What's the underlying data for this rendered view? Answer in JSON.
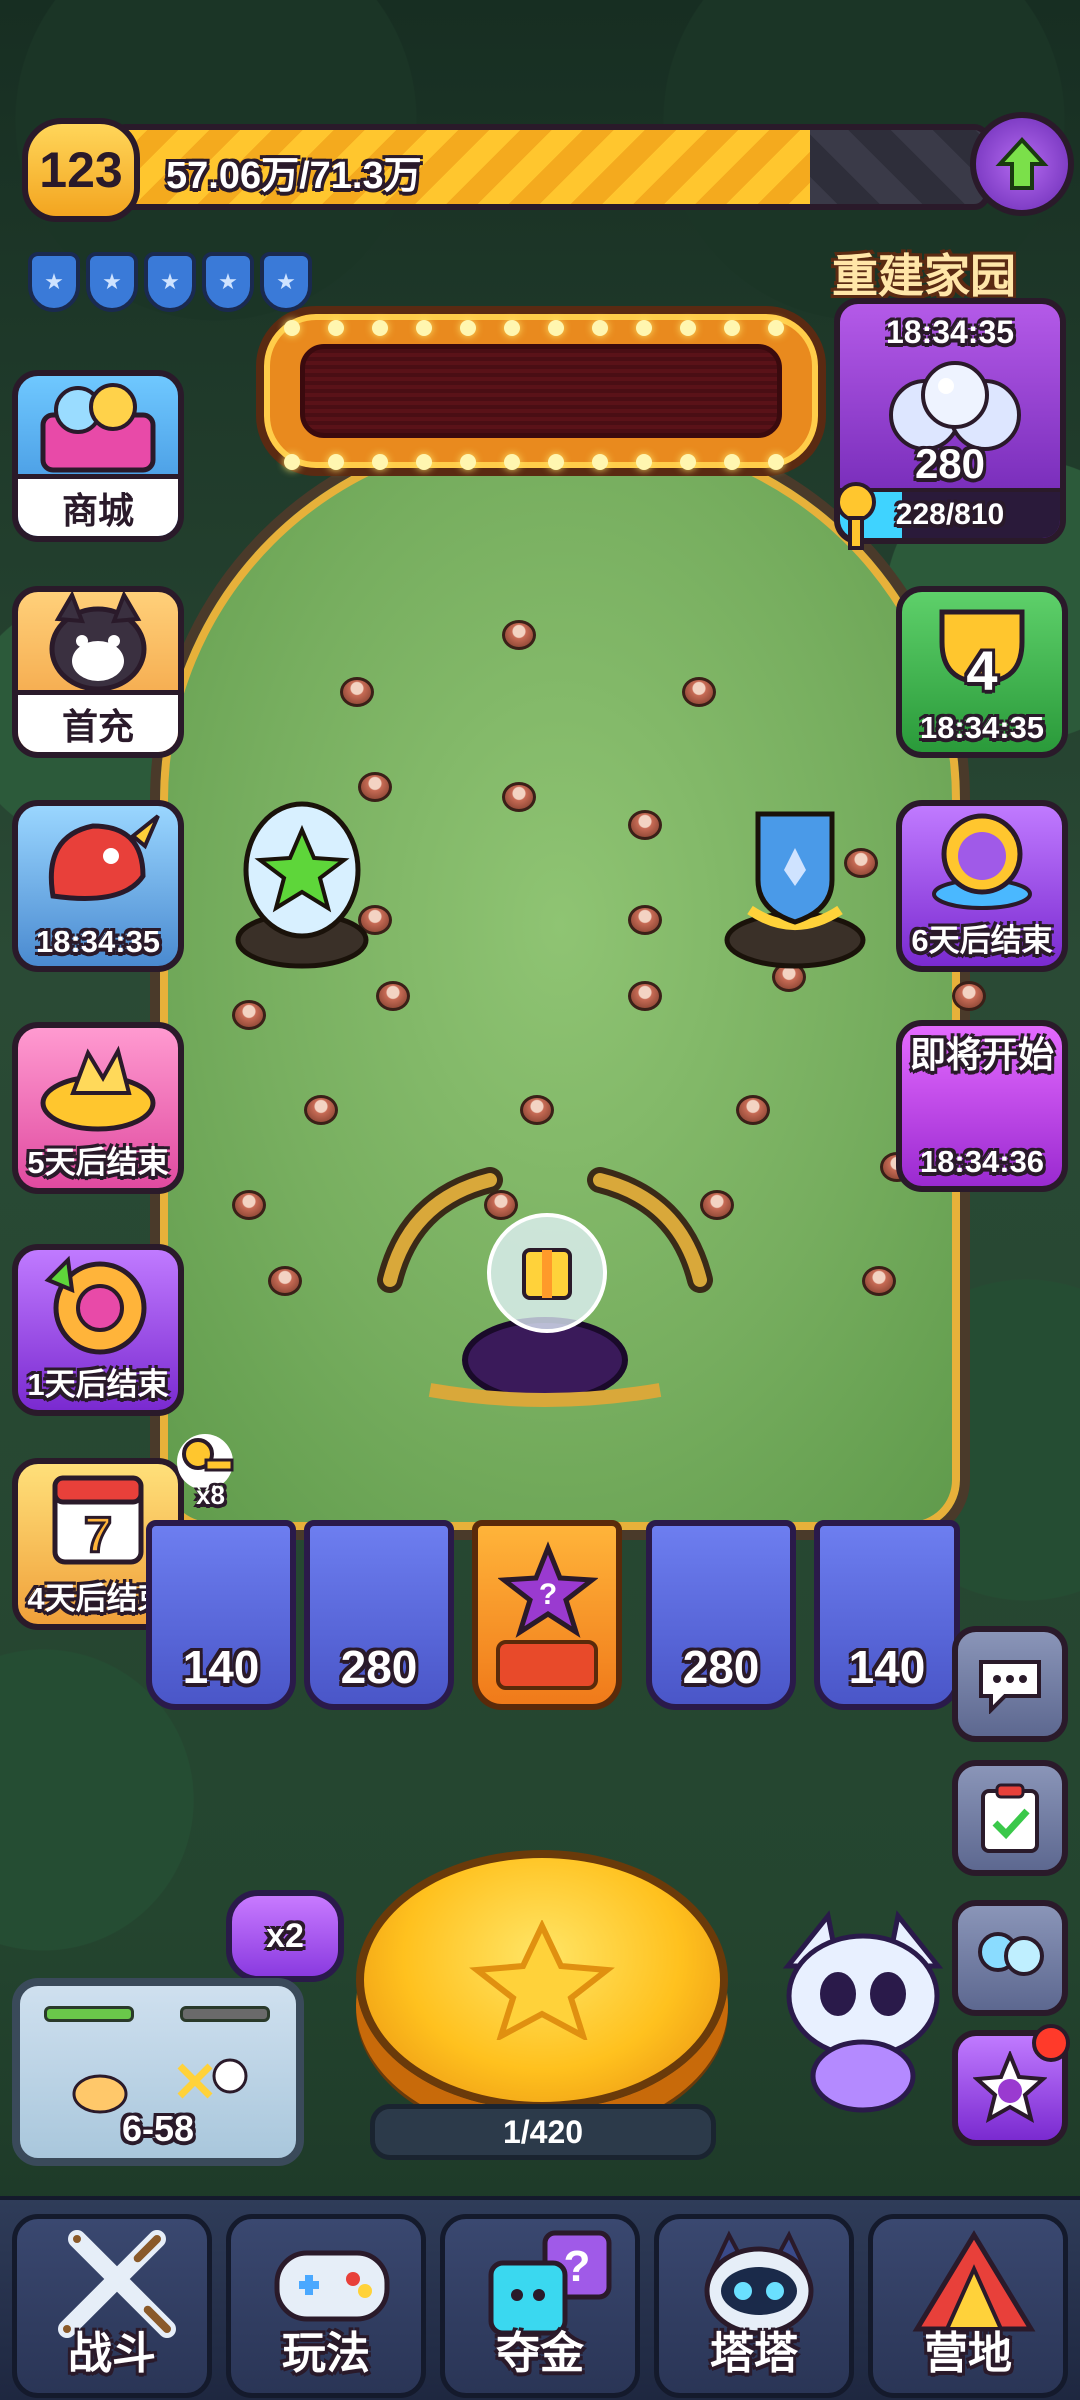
{
  "player": {
    "level": "123",
    "xp_text": "57.06万/71.3万",
    "xp_progress": 0.8
  },
  "shields": {
    "count": 5
  },
  "home_event": {
    "title": "重建家园",
    "timer": "18:34:35",
    "reward_count": "280",
    "progress_text": "228/810",
    "progress": 0.28
  },
  "left_buttons": [
    {
      "id": "shop",
      "label": "商城"
    },
    {
      "id": "first-recharge",
      "label": "首充"
    },
    {
      "id": "event-bird",
      "label": "18:34:35"
    },
    {
      "id": "event-gold",
      "label": "5天后结束"
    },
    {
      "id": "event-wheel",
      "label": "1天后结束"
    },
    {
      "id": "event-calendar",
      "label": "4天后结束",
      "calendar_day": "7"
    }
  ],
  "right_buttons": [
    {
      "id": "trophy",
      "label": "18:34:35",
      "count": "4"
    },
    {
      "id": "cat-medal",
      "label": "6天后结束"
    },
    {
      "id": "upcoming",
      "label_top": "即将开始",
      "label": "18:34:36"
    }
  ],
  "key_multiplier": "x8",
  "slots": [
    {
      "value": "140"
    },
    {
      "value": "280"
    },
    {
      "value": "mystery"
    },
    {
      "value": "280"
    },
    {
      "value": "140"
    }
  ],
  "multiplier_button": "x2",
  "spin_progress": "1/420",
  "stage": {
    "label": "6-58"
  },
  "nav": [
    {
      "id": "battle",
      "label": "战斗"
    },
    {
      "id": "modes",
      "label": "玩法"
    },
    {
      "id": "treasure",
      "label": "夺金"
    },
    {
      "id": "tata",
      "label": "塔塔"
    },
    {
      "id": "camp",
      "label": "营地"
    }
  ],
  "colors": {
    "gold": "#ffc62e",
    "purple": "#8a3ae0",
    "grass": "#77ae5f",
    "nav_bg": "#2f3c59"
  }
}
